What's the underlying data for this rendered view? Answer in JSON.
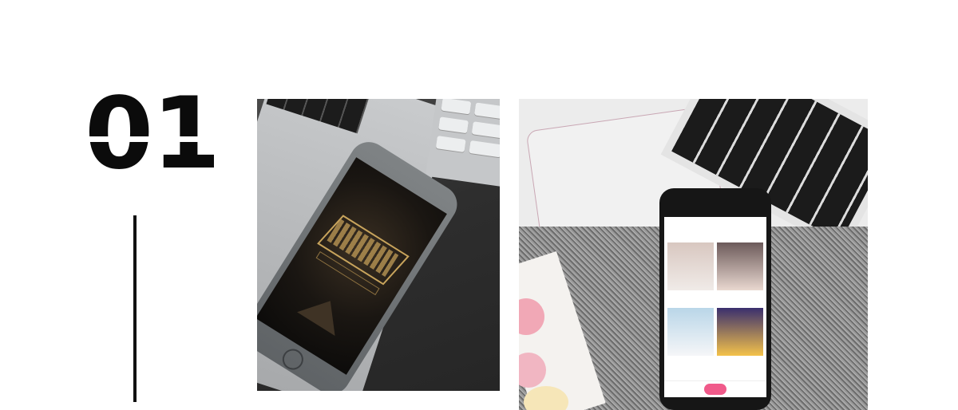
{
  "section_number": "01",
  "photos": {
    "left": {
      "description_label": ""
    },
    "right": {
      "description_label": ""
    }
  },
  "colors": {
    "accent": "#0b0b0b",
    "app_accent": "#e8457a"
  }
}
